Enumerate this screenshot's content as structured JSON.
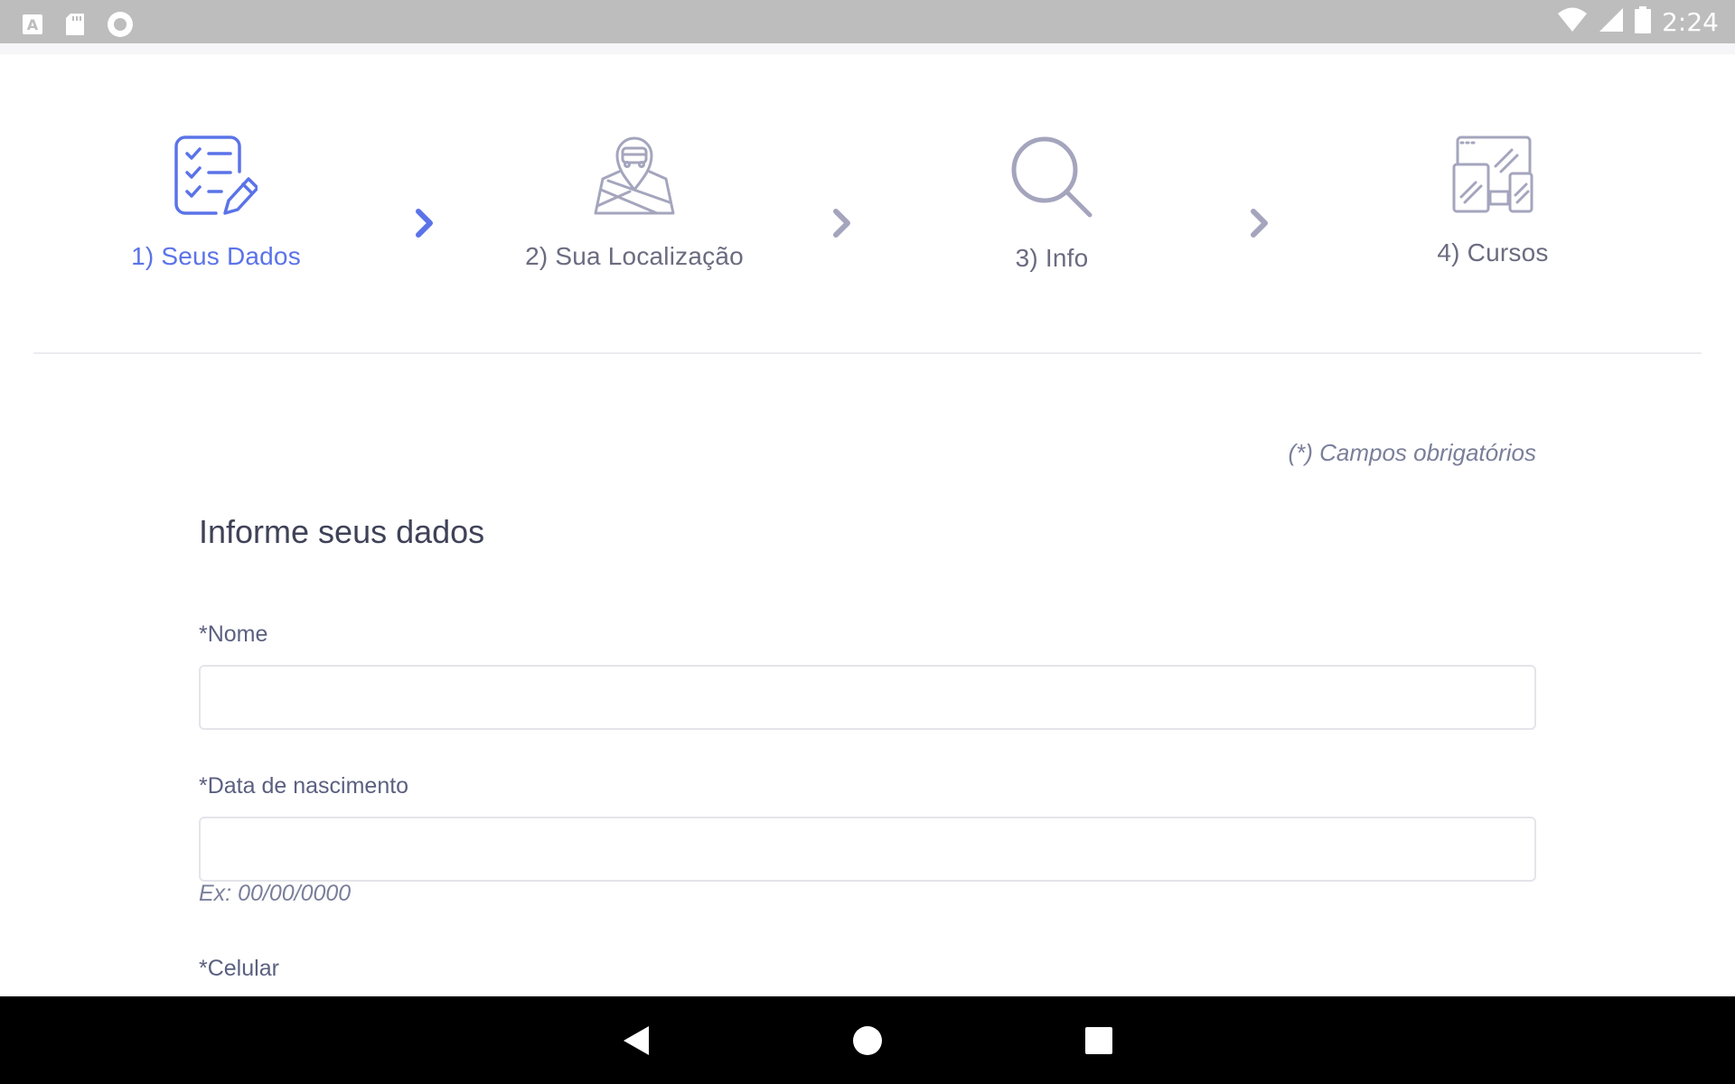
{
  "status_bar": {
    "time": "2:24",
    "left_icons": [
      "font-a-icon",
      "sd-card-icon",
      "record-icon"
    ],
    "right_icons": [
      "wifi-icon",
      "cell-signal-icon",
      "battery-icon"
    ]
  },
  "stepper": {
    "steps": [
      {
        "label": "1) Seus Dados",
        "icon": "checklist-pencil-icon",
        "active": true
      },
      {
        "label": "2) Sua Localização",
        "icon": "map-bus-icon",
        "active": false
      },
      {
        "label": "3) Info",
        "icon": "search-icon",
        "active": false
      },
      {
        "label": "4) Cursos",
        "icon": "devices-icon",
        "active": false
      }
    ]
  },
  "form": {
    "required_note": "(*) Campos obrigatórios",
    "title": "Informe seus dados",
    "fields": [
      {
        "label": "*Nome",
        "value": "",
        "placeholder": ""
      },
      {
        "label": "*Data de nascimento",
        "value": "",
        "placeholder": "",
        "hint": "Ex: 00/00/0000"
      },
      {
        "label": "*Celular"
      }
    ]
  },
  "nav_bar": {
    "buttons": [
      "back-icon",
      "home-icon",
      "recents-icon"
    ]
  },
  "colors": {
    "accent": "#5b73e8",
    "inactive": "#a4a5bd",
    "status_bar": "#bdbdbd",
    "nav_bar": "#000000"
  }
}
